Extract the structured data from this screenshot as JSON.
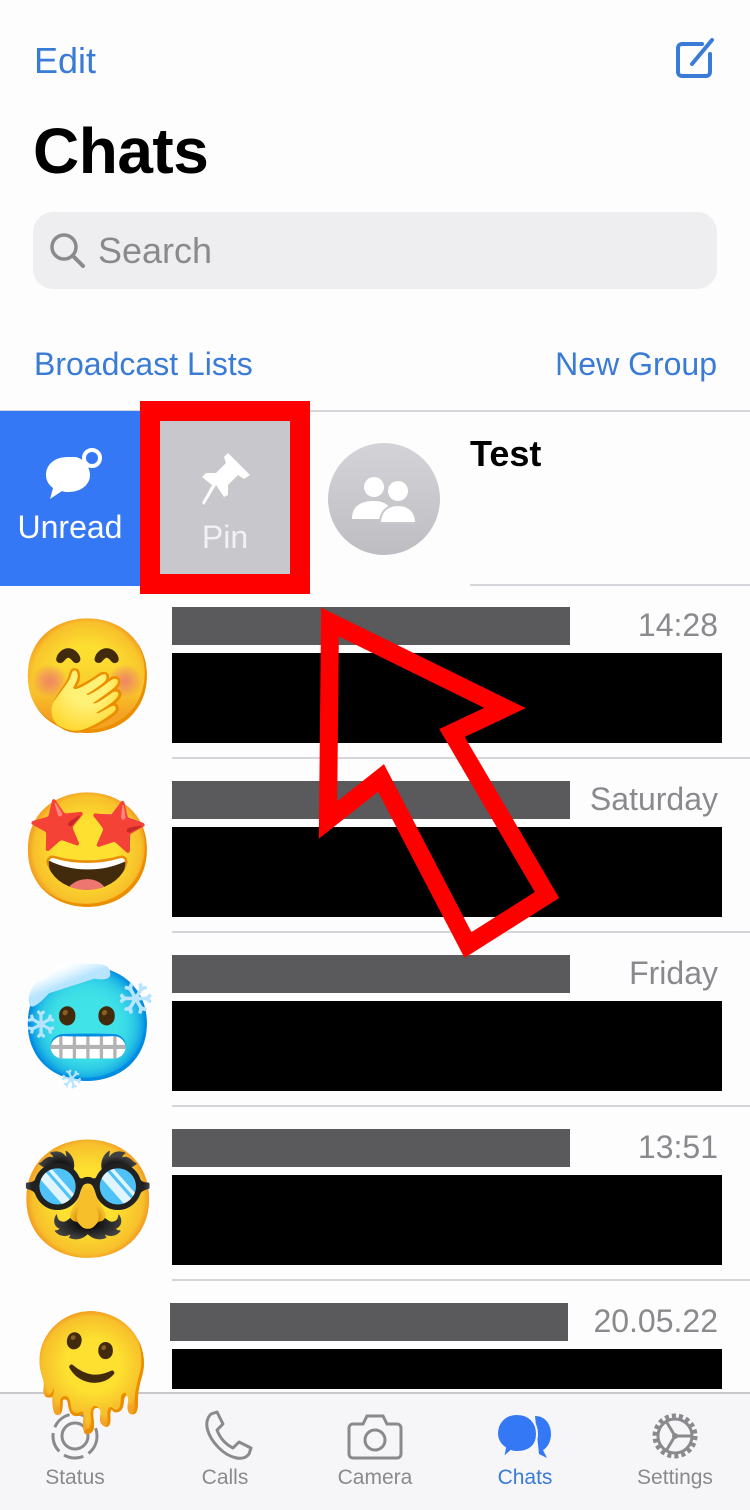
{
  "header": {
    "edit_label": "Edit",
    "compose_icon": "compose-icon",
    "title": "Chats"
  },
  "search": {
    "placeholder": "Search",
    "icon": "search-icon"
  },
  "links": {
    "broadcast_lists": "Broadcast Lists",
    "new_group": "New Group"
  },
  "swipe_row": {
    "actions": [
      {
        "label": "Unread",
        "icon": "unread-icon",
        "color": "#3478F6"
      },
      {
        "label": "Pin",
        "icon": "pin-icon",
        "color": "#C7C7CC"
      }
    ],
    "chat_name": "Test",
    "avatar_icon": "group-icon"
  },
  "chats": [
    {
      "emoji": "🤭",
      "time": "14:28",
      "name": "[redacted]",
      "message": "[redacted]"
    },
    {
      "emoji": "🤩",
      "time": "Saturday",
      "name": "[redacted]",
      "message": "[redacted]"
    },
    {
      "emoji": "🥶",
      "time": "Friday",
      "name": "[redacted]",
      "message": "[redacted]"
    },
    {
      "emoji": "🥸",
      "time": "13:51",
      "name": "[redacted]",
      "message": "[redacted]"
    },
    {
      "emoji": "🫠",
      "time": "20.05.22",
      "name": "[redacted]",
      "message": "[redacted]"
    }
  ],
  "tabbar": {
    "tabs": [
      {
        "label": "Status",
        "icon": "status-icon",
        "active": false
      },
      {
        "label": "Calls",
        "icon": "phone-icon",
        "active": false
      },
      {
        "label": "Camera",
        "icon": "camera-icon",
        "active": false
      },
      {
        "label": "Chats",
        "icon": "chats-icon",
        "active": true
      },
      {
        "label": "Settings",
        "icon": "gear-icon",
        "active": false
      }
    ]
  },
  "annotation": {
    "highlight_color": "#FF0000",
    "description": "red box around Pin action and red arrow pointing to it"
  }
}
